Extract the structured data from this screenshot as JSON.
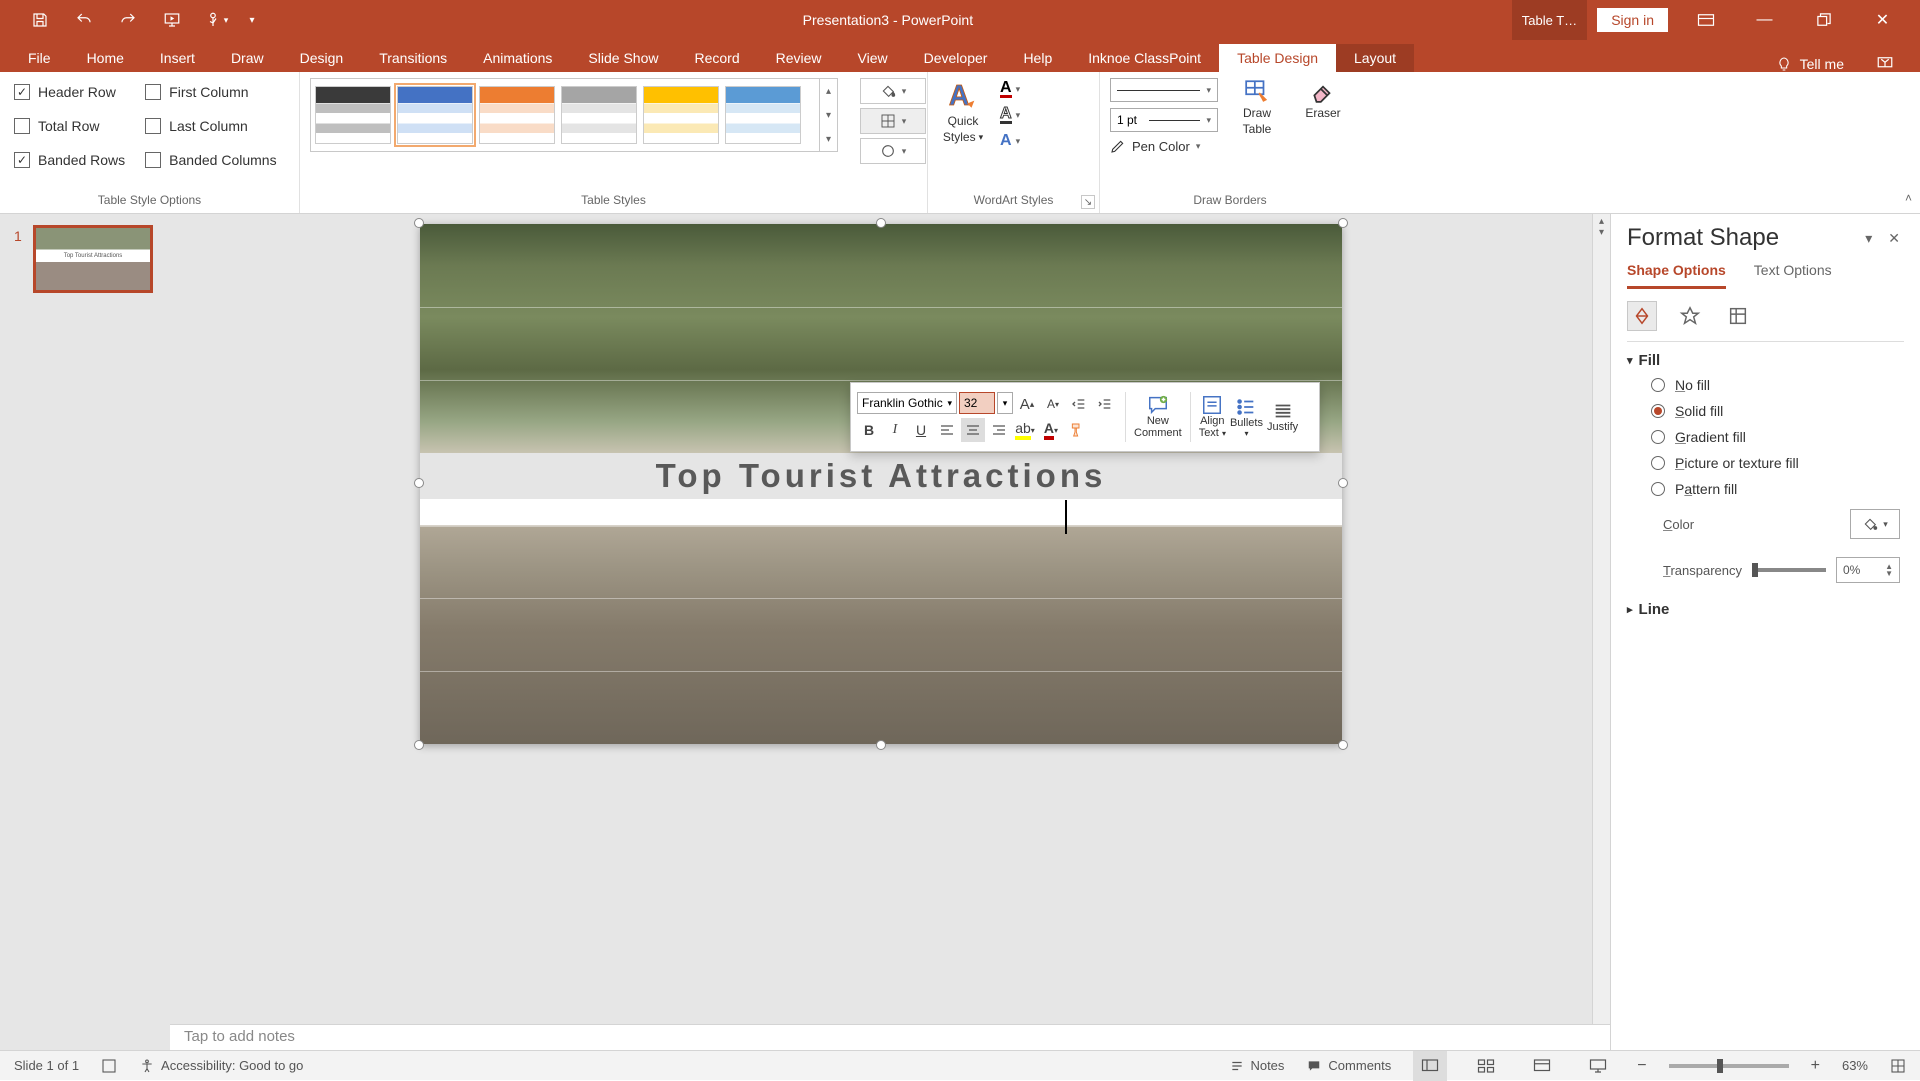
{
  "titlebar": {
    "title": "Presentation3  -  PowerPoint",
    "tool_tab": "Table T…",
    "signin": "Sign in"
  },
  "ribbon_tabs": {
    "file": "File",
    "items": [
      "Home",
      "Insert",
      "Draw",
      "Design",
      "Transitions",
      "Animations",
      "Slide Show",
      "Record",
      "Review",
      "View",
      "Developer",
      "Help",
      "Inknoe ClassPoint"
    ],
    "tool1": "Table Design",
    "tool2": "Layout",
    "tellme": "Tell me"
  },
  "ribbon": {
    "group1": {
      "label": "Table Style Options",
      "header_row": "Header Row",
      "total_row": "Total Row",
      "banded_rows": "Banded Rows",
      "first_col": "First Column",
      "last_col": "Last Column",
      "banded_cols": "Banded Columns"
    },
    "group2": {
      "label": "Table Styles"
    },
    "group3": {
      "label": "WordArt Styles",
      "quick": "Quick",
      "styles": "Styles"
    },
    "group4": {
      "label": "Draw Borders",
      "weight": "1 pt",
      "pen_color": "Pen Color",
      "draw_table": "Draw\nTable",
      "draw1": "Draw",
      "draw2": "Table",
      "eraser": "Eraser"
    }
  },
  "style_swatches": [
    {
      "hdr": "#3a3a3a",
      "row": "#bfbfbf"
    },
    {
      "hdr": "#4472C4",
      "row": "#cfe0f5"
    },
    {
      "hdr": "#ED7D31",
      "row": "#f9dcc7"
    },
    {
      "hdr": "#A5A5A5",
      "row": "#e4e4e4"
    },
    {
      "hdr": "#FFC000",
      "row": "#fbe9b5"
    },
    {
      "hdr": "#5B9BD5",
      "row": "#d6e7f5"
    }
  ],
  "thumbs": {
    "num": "1",
    "mini_title": "Top Tourist Attractions"
  },
  "slide": {
    "title": "Top Tourist Attractions"
  },
  "mini": {
    "font": "Franklin Gothic",
    "size": "32",
    "new_comment1": "New",
    "new_comment2": "Comment",
    "align1": "Align",
    "align2": "Text",
    "bullets": "Bullets",
    "justify": "Justify"
  },
  "notes_placeholder": "Tap to add notes",
  "pane": {
    "title": "Format Shape",
    "tab1": "Shape Options",
    "tab2": "Text Options",
    "fill": "Fill",
    "line": "Line",
    "no_fill": "No fill",
    "solid_fill": "Solid fill",
    "gradient_fill": "Gradient fill",
    "picture_fill": "Picture or texture fill",
    "pattern_fill": "Pattern fill",
    "color": "Color",
    "transparency": "Transparency",
    "transparency_val": "0%"
  },
  "status": {
    "slide": "Slide 1 of 1",
    "accessibility": "Accessibility: Good to go",
    "notes": "Notes",
    "comments": "Comments",
    "zoom": "63%"
  }
}
